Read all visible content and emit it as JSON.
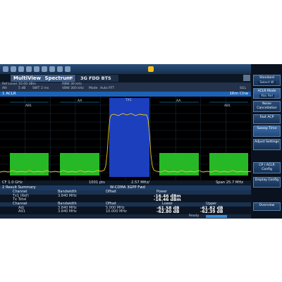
{
  "toolbar": {
    "icons": [
      "menu-icon",
      "open-icon",
      "save-icon",
      "print-icon",
      "undo-icon",
      "redo-icon",
      "zoom-icon",
      "marker-icon",
      "split-icon",
      "help-icon"
    ]
  },
  "tabs": {
    "main": "MultiView",
    "main_sub": "Spectrum",
    "second": "3G FDD BTS"
  },
  "info": {
    "ref_level_label": "Ref Level",
    "ref_level_value": "10.00 dBm",
    "att_label": "Att",
    "att_value": "5 dB",
    "swt_label": "SWT",
    "swt_value": "2 ms",
    "rbw_label": "RBW",
    "rbw_value": "30 kHz",
    "vbw_label": "VBW",
    "vbw_value": "300 kHz",
    "mode_label": "Mode",
    "mode_value": "Auto FFT",
    "sgl": "SGL"
  },
  "trace_header": {
    "name": "1 ACLR",
    "right": "1Rm Clrw"
  },
  "plot": {
    "channel_labels": [
      "AB1",
      "AA",
      "TX1",
      "AA",
      "AB1"
    ]
  },
  "axis": {
    "left": "CF 1.0 GHz",
    "middle": "1001 pts",
    "center": "2.57 MHz/",
    "right": "Span 25.7 MHz"
  },
  "result_summary": {
    "title": "2 Result Summary",
    "standard": "W-CDMA 3GPP Fwd"
  },
  "table1": {
    "headers": [
      "Channel",
      "Bandwidth",
      "Offset",
      "Power"
    ],
    "rows": [
      [
        "Tx1 (Ref)",
        "3.840 MHz",
        "",
        "-16.46 dBm"
      ],
      [
        "Tx Total",
        "",
        "",
        "-16.46 dBm"
      ]
    ]
  },
  "table2": {
    "headers": [
      "Channel",
      "Bandwidth",
      "Offset",
      "Lower",
      "Upper"
    ],
    "rows": [
      [
        "Adj",
        "3.840 MHz",
        "5.000 MHz",
        "-61.58 dB",
        "-61.82 dB"
      ],
      [
        "Alt1",
        "3.840 MHz",
        "10.000 MHz",
        "-62.80 dB",
        "-62.39 dB"
      ]
    ]
  },
  "status": {
    "ready": "Ready"
  },
  "softkeys": [
    {
      "label": "Standard",
      "indicator": "Select W"
    },
    {
      "label": "ACLR Mode",
      "indicator": "Abs Rel"
    },
    {
      "label": "Noise Cancellation",
      "indicator": ""
    },
    {
      "label": "Fast ACP",
      "indicator": ""
    },
    {
      "label": "Sweep Time",
      "indicator": ""
    },
    {
      "label": "Adjust Settings",
      "indicator": ""
    },
    {
      "label": "CP / ACLR Config",
      "indicator": ""
    },
    {
      "label": "Display Config",
      "indicator": ""
    },
    {
      "label": "Overview",
      "indicator": ""
    }
  ],
  "colors": {
    "tx_channel": "#1c3fbd",
    "adjacent": "#27b828",
    "trace": "#f0c81e",
    "accent": "#1c63b8"
  }
}
